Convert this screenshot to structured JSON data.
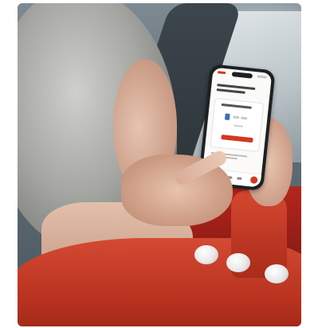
{
  "scene": {
    "subject": "",
    "colors": {
      "sweater": "#c23a26",
      "phone_accent": "#d2381f",
      "hair": "#a6a7a3",
      "background": "#5e6c75"
    }
  },
  "phone_screen": {
    "brand_color": "#d2381f",
    "toggle_color": "#3a6fb8",
    "icons": [
      "status-logo-icon",
      "battery-icon",
      "home-tab-icon",
      "menu-tab-icon",
      "chat-fab-icon"
    ]
  }
}
